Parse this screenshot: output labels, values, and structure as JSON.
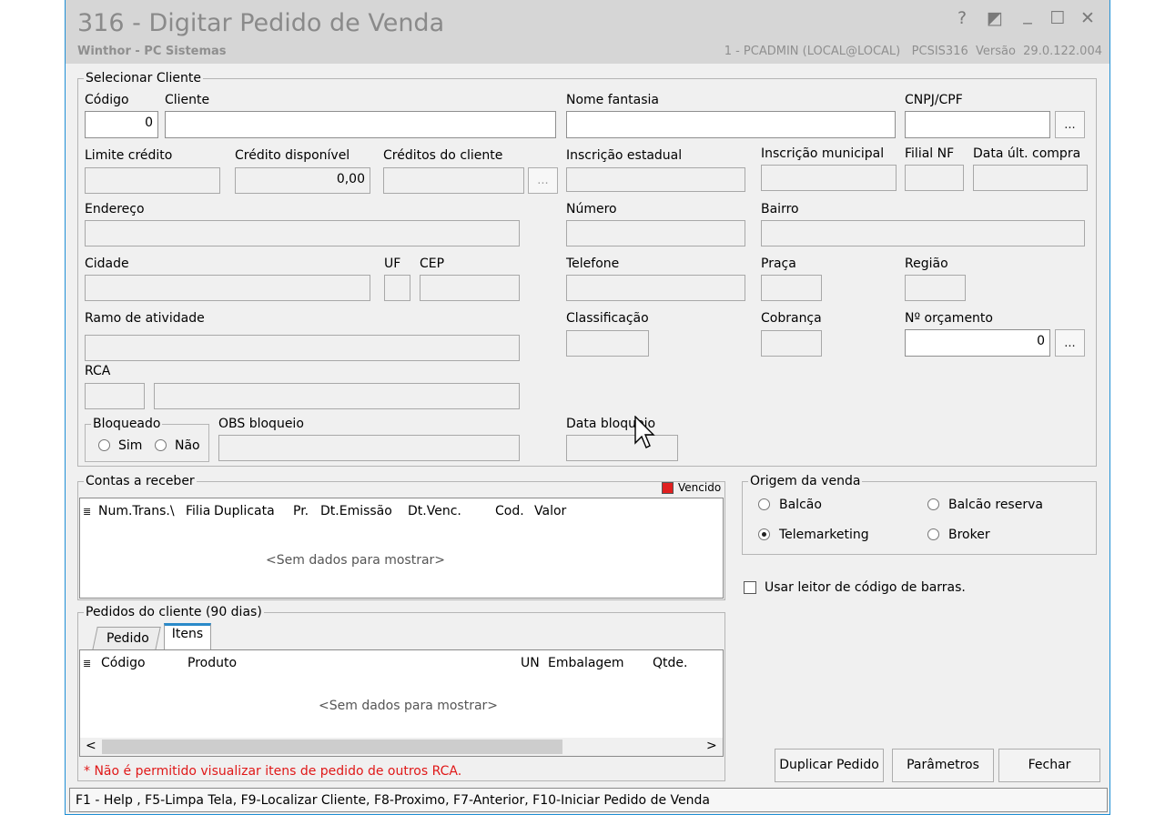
{
  "window": {
    "title": "316 - Digitar Pedido de Venda",
    "subtitle": "Winthor - PC Sistemas",
    "user_info": "1 - PCADMIN (LOCAL@LOCAL)   PCSIS316  Versão  29.0.122.004",
    "help_glyph": "?",
    "restore_glyph": "◩",
    "minimize_glyph": "_",
    "maximize_glyph": "☐",
    "close_glyph": "✕"
  },
  "cliente": {
    "group_label": "Selecionar Cliente",
    "codigo_label": "Código",
    "codigo_value": "0",
    "cliente_label": "Cliente",
    "cliente_value": "",
    "nome_fantasia_label": "Nome fantasia",
    "cnpj_label": "CNPJ/CPF",
    "lookup_label": "...",
    "limite_credito_label": "Limite crédito",
    "credito_disponivel_label": "Crédito disponível",
    "credito_disponivel_value": "0,00",
    "creditos_cliente_label": "Créditos do cliente",
    "inscricao_estadual_label": "Inscrição estadual",
    "inscricao_municipal_label": "Inscrição municipal",
    "filial_nf_label": "Filial NF",
    "data_ult_compra_label": "Data últ. compra",
    "endereco_label": "Endereço",
    "numero_label": "Número",
    "bairro_label": "Bairro",
    "cidade_label": "Cidade",
    "uf_label": "UF",
    "cep_label": "CEP",
    "telefone_label": "Telefone",
    "praca_label": "Praça",
    "regiao_label": "Região",
    "ramo_label": "Ramo de atividade",
    "classificacao_label": "Classificação",
    "cobranca_label": "Cobrança",
    "orcamento_label": "Nº orçamento",
    "orcamento_value": "0",
    "rca_label": "RCA",
    "bloqueado_label": "Bloqueado",
    "sim_label": "Sim",
    "nao_label": "Não",
    "obs_bloqueio_label": "OBS bloqueio",
    "data_bloqueio_label": "Data bloqueio"
  },
  "contas": {
    "group_label": "Contas a receber",
    "vencido_label": "Vencido",
    "vencido_color": "#e02020",
    "columns": [
      "Num.Trans.\\",
      "Filia",
      "Duplicata",
      "Pr.",
      "Dt.Emissão",
      "Dt.Venc.",
      "Cod.",
      "Valor"
    ],
    "empty": "<Sem dados para mostrar>"
  },
  "origem": {
    "group_label": "Origem da venda",
    "balcao": "Balcão",
    "balcao_reserva": "Balcão reserva",
    "telemarketing": "Telemarketing",
    "broker": "Broker"
  },
  "barcode_label": "Usar leitor de código de barras.",
  "pedidos": {
    "group_label": "Pedidos do cliente (90 dias)",
    "tab_pedido": "Pedido",
    "tab_itens": "Itens",
    "columns": [
      "Código",
      "Produto",
      "UN",
      "Embalagem",
      "Qtde."
    ],
    "empty": "<Sem dados para mostrar>",
    "scroll_left": "<",
    "scroll_right": ">",
    "warning": "* Não é permitido visualizar itens de pedido de outros RCA."
  },
  "buttons": {
    "duplicar": "Duplicar Pedido",
    "parametros": "Parâmetros",
    "fechar": "Fechar"
  },
  "status_bar": "F1 - Help , F5-Limpa Tela, F9-Localizar Cliente, F8-Proximo, F7-Anterior, F10-Iniciar Pedido de Venda"
}
